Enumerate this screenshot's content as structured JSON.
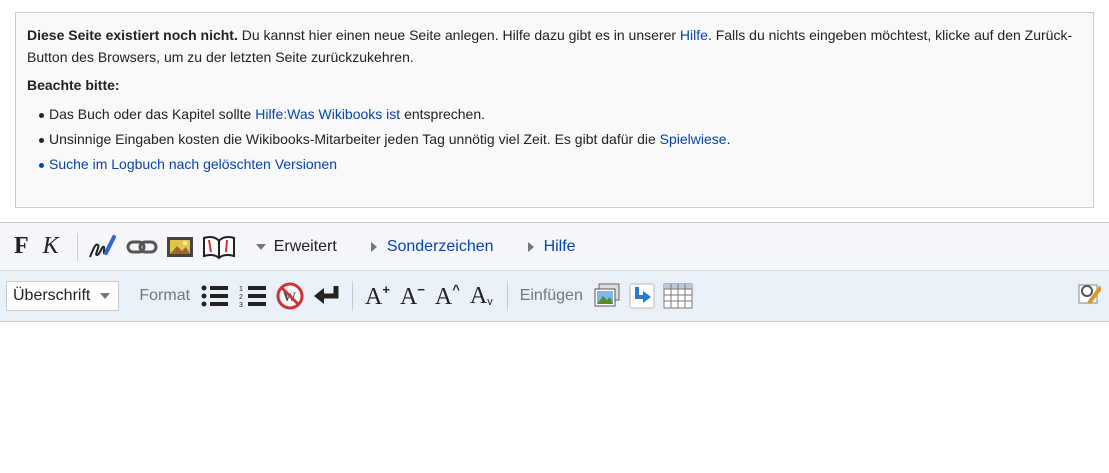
{
  "notice": {
    "intro_bold": "Diese Seite existiert noch nicht.",
    "intro_text_1": " Du kannst hier einen neue Seite anlegen. Hilfe dazu gibt es in unserer ",
    "intro_link_hilfe": "Hilfe",
    "intro_text_2": ". Falls du nichts eingeben möchtest, klicke auf den Zurück-Button des Browsers, um zu der letzten Seite zurückzukehren.",
    "beachte": "Beachte bitte:",
    "bullet1_pre": "Das Buch oder das Kapitel sollte ",
    "bullet1_link": "Hilfe:Was Wikibooks ist",
    "bullet1_post": " entsprechen.",
    "bullet2_pre": "Unsinnige Eingaben kosten die Wikibooks-Mitarbeiter jeden Tag unnötig viel Zeit. Es gibt dafür die ",
    "bullet2_link": "Spielwiese",
    "bullet2_post": ".",
    "bullet3_link": "Suche im Logbuch nach gelöschten Versionen"
  },
  "toolbar1": {
    "bold": "F",
    "italic": "K",
    "icons": [
      "signature-icon",
      "link-icon",
      "image-icon",
      "reference-icon"
    ],
    "erweitert": "Erweitert",
    "sonderzeichen": "Sonderzeichen",
    "hilfe": "Hilfe"
  },
  "toolbar2": {
    "heading_select": "Überschrift",
    "format_label": "Format",
    "font_buttons": [
      {
        "base": "A",
        "mod": "+"
      },
      {
        "base": "A",
        "mod": "−"
      },
      {
        "base": "A",
        "mod": "^"
      },
      {
        "base": "A",
        "mod": "v"
      }
    ],
    "insert_label": "Einfügen"
  }
}
